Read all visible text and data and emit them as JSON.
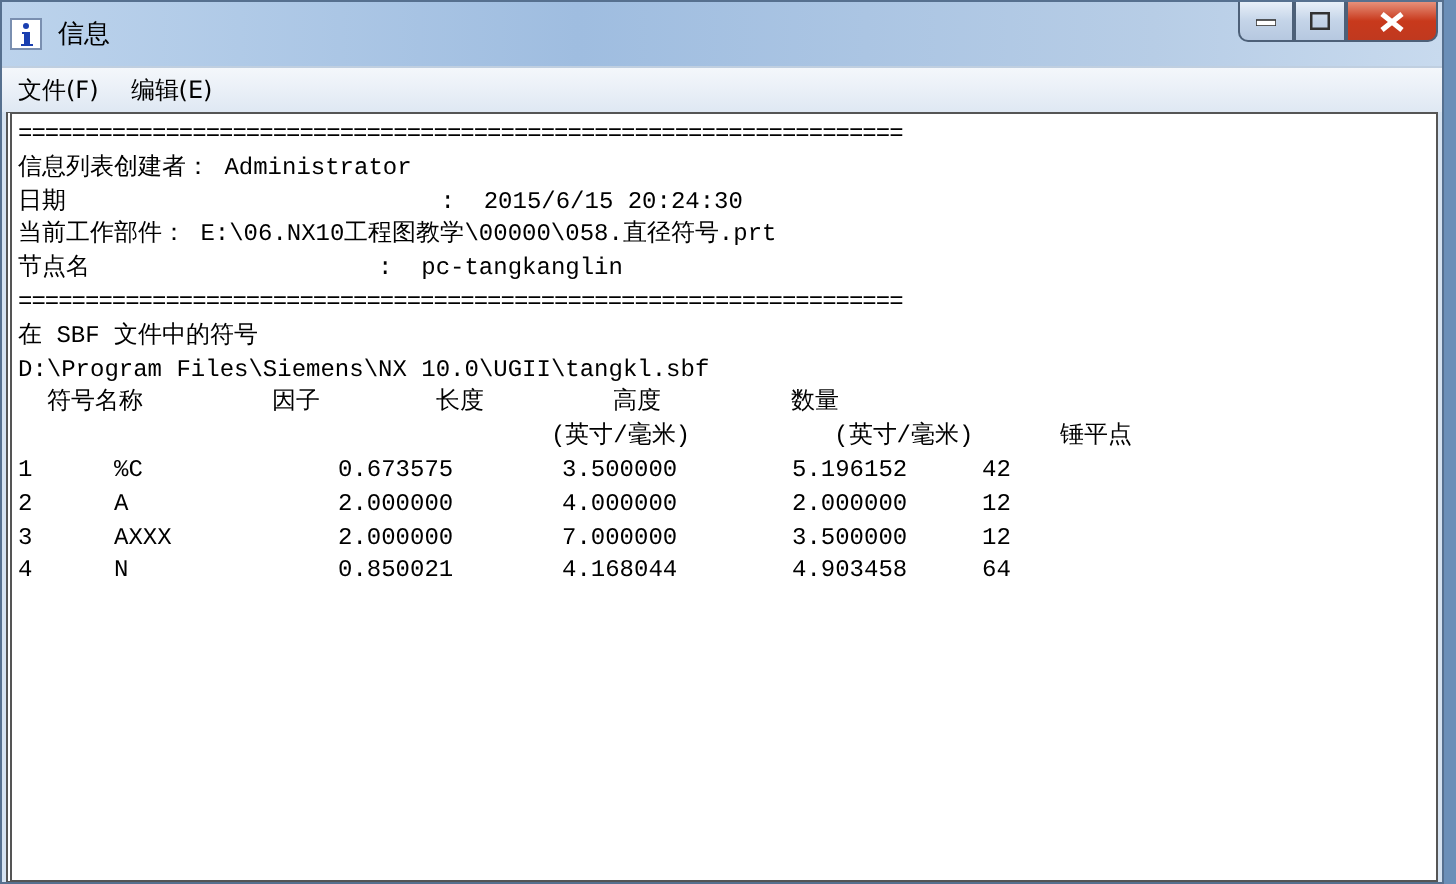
{
  "window": {
    "title": "信息"
  },
  "menu": [
    {
      "label": "文件(F)"
    },
    {
      "label": "编辑(E)"
    }
  ],
  "lines": [
    {
      "kind": "rule",
      "text": "=================================================================="
    },
    {
      "kind": "text",
      "text": "信息列表创建者： Administrator"
    },
    {
      "kind": "text",
      "text": "日期                          :  2015/6/15 20:24:30"
    },
    {
      "kind": "text",
      "text": "当前工作部件： E:\\06.NX10工程图教学\\00000\\058.直径符号.prt"
    },
    {
      "kind": "text",
      "text": "节点名                    :  pc-tangkanglin"
    },
    {
      "kind": "rule",
      "text": "=================================================================="
    },
    {
      "kind": "text",
      "text": "在 SBF 文件中的符号"
    },
    {
      "kind": "text",
      "text": "D:\\Program Files\\Siemens\\NX 10.0\\UGII\\tangkl.sbf"
    },
    {
      "kind": "text",
      "text": "  符号名称         因子        长度         高度         数量"
    },
    {
      "kind": "text",
      "text": "                                     (英寸/毫米)          (英寸/毫米)      锤平点"
    }
  ],
  "table": {
    "rows": [
      {
        "cells": [
          "1",
          "%C",
          "0.673575",
          "3.500000",
          "5.196152",
          "42"
        ]
      },
      {
        "cells": [
          "2",
          "A",
          "2.000000",
          "4.000000",
          "2.000000",
          "12"
        ]
      },
      {
        "cells": [
          "3",
          "AXXX",
          "2.000000",
          "7.000000",
          "3.500000",
          "12"
        ]
      },
      {
        "cells": [
          "4",
          "N",
          "0.850021",
          "4.168044",
          "4.903458",
          "64"
        ]
      }
    ]
  }
}
